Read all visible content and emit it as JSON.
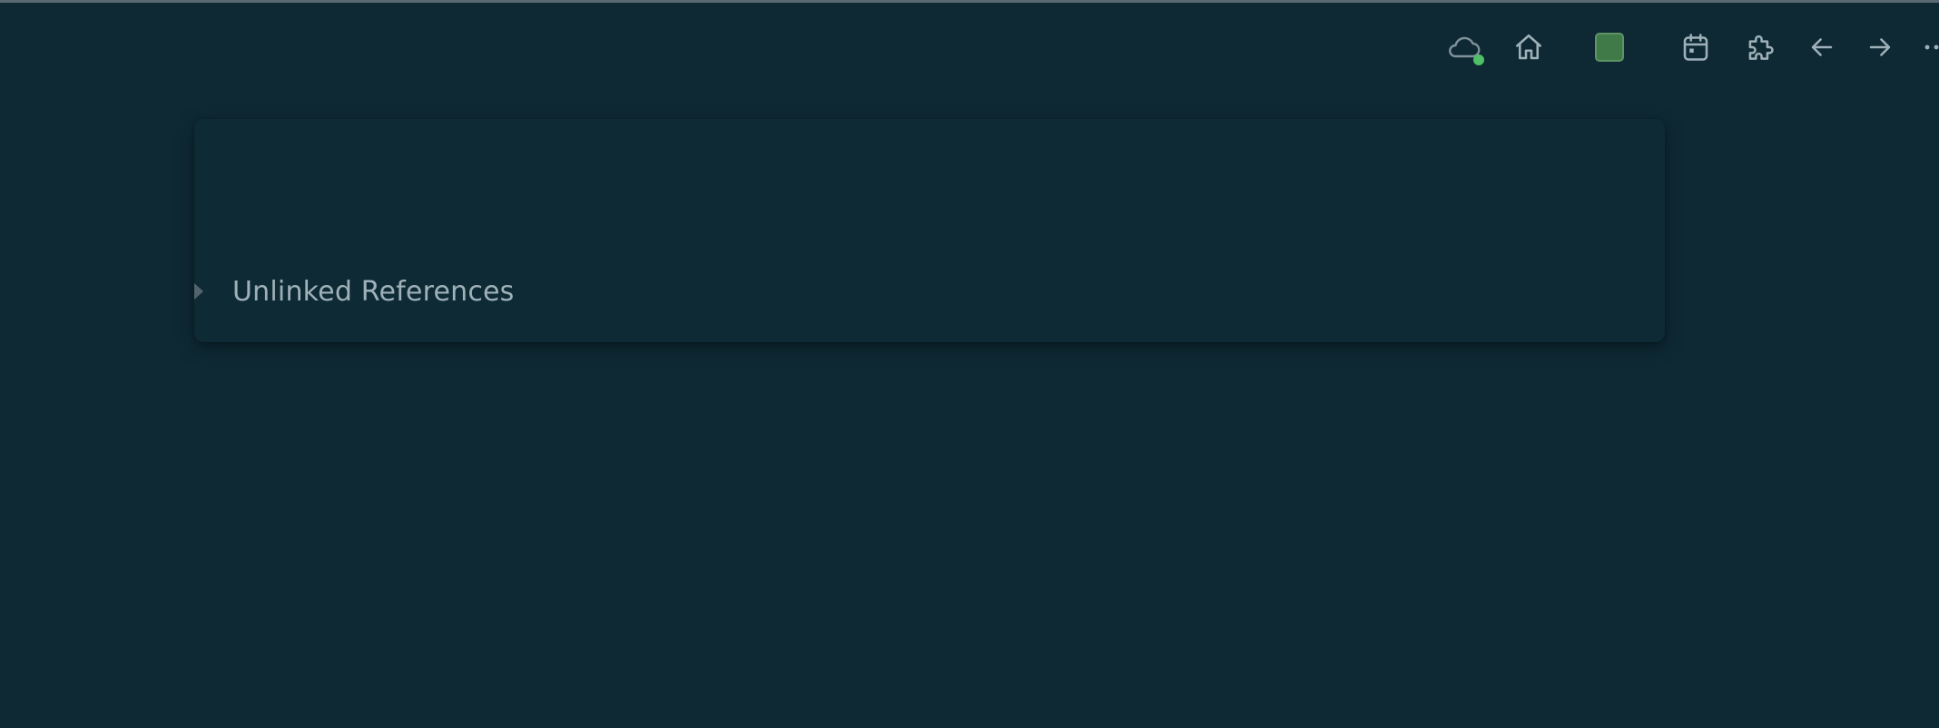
{
  "toolbar": {
    "icons": [
      {
        "name": "cloud-sync-icon"
      },
      {
        "name": "home-icon"
      },
      {
        "name": "color-swatch"
      },
      {
        "name": "calendar-icon"
      },
      {
        "name": "puzzle-icon"
      },
      {
        "name": "arrow-left-icon"
      },
      {
        "name": "arrow-right-icon"
      },
      {
        "name": "more-icon"
      }
    ],
    "status_color": "#4fbf68",
    "swatch_color": "#3f7a48"
  },
  "references": {
    "unlinked_label": "Unlinked References"
  },
  "colors": {
    "background": "#0e2934",
    "icon": "#9fb1b8"
  }
}
